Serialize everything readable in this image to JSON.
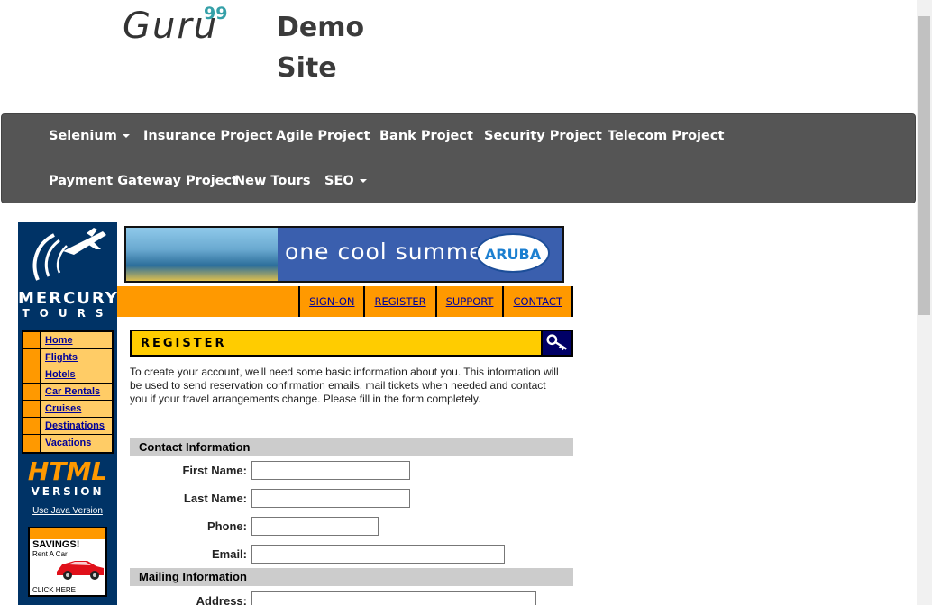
{
  "header": {
    "logo_text": "Guru",
    "logo_sup": "99",
    "site_title": "Demo Site"
  },
  "navbar": {
    "items": [
      {
        "label": "Selenium",
        "dropdown": true
      },
      {
        "label": "Insurance Project"
      },
      {
        "label": "Agile Project"
      },
      {
        "label": "Bank Project"
      },
      {
        "label": "Security Project"
      },
      {
        "label": "Telecom Project"
      },
      {
        "label": "Payment Gateway Project"
      },
      {
        "label": "New Tours"
      },
      {
        "label": "SEO",
        "dropdown": true
      }
    ]
  },
  "mercury": {
    "brand_top": "MERCURY",
    "brand_bottom": "TOURS",
    "side_menu": [
      "Home",
      "Flights",
      "Hotels",
      "Car Rentals",
      "Cruises",
      "Destinations",
      "Vacations"
    ],
    "html_version": {
      "big": "HTML",
      "small": "VERSION"
    },
    "java_link": "Use Java Version",
    "ad": {
      "headline": "SAVINGS!",
      "sub": "Rent A Car",
      "cta": "CLICK HERE"
    },
    "banner": {
      "text": "one cool summer",
      "badge": "ARUBA"
    },
    "top_nav": [
      "SIGN-ON",
      "REGISTER",
      "SUPPORT",
      "CONTACT"
    ],
    "register_title": "REGISTER",
    "intro": "To create your account, we'll need some basic information about you. This information will be used to send reservation confirmation emails, mail tickets when needed and contact you if your travel arrangements change. Please fill in the form completely.",
    "sections": {
      "contact": "Contact Information",
      "mailing": "Mailing Information"
    },
    "fields": {
      "first_name": {
        "label": "First Name:",
        "value": ""
      },
      "last_name": {
        "label": "Last Name:",
        "value": ""
      },
      "phone": {
        "label": "Phone:",
        "value": ""
      },
      "email": {
        "label": "Email:",
        "value": ""
      },
      "address": {
        "label": "Address:",
        "value": ""
      }
    }
  },
  "colors": {
    "navbar_bg": "#555555",
    "mercury_blue": "#003366",
    "orange": "#ff9900",
    "yellow": "#ffcc00",
    "link_blue": "#000099",
    "section_gray": "#cccccc"
  }
}
